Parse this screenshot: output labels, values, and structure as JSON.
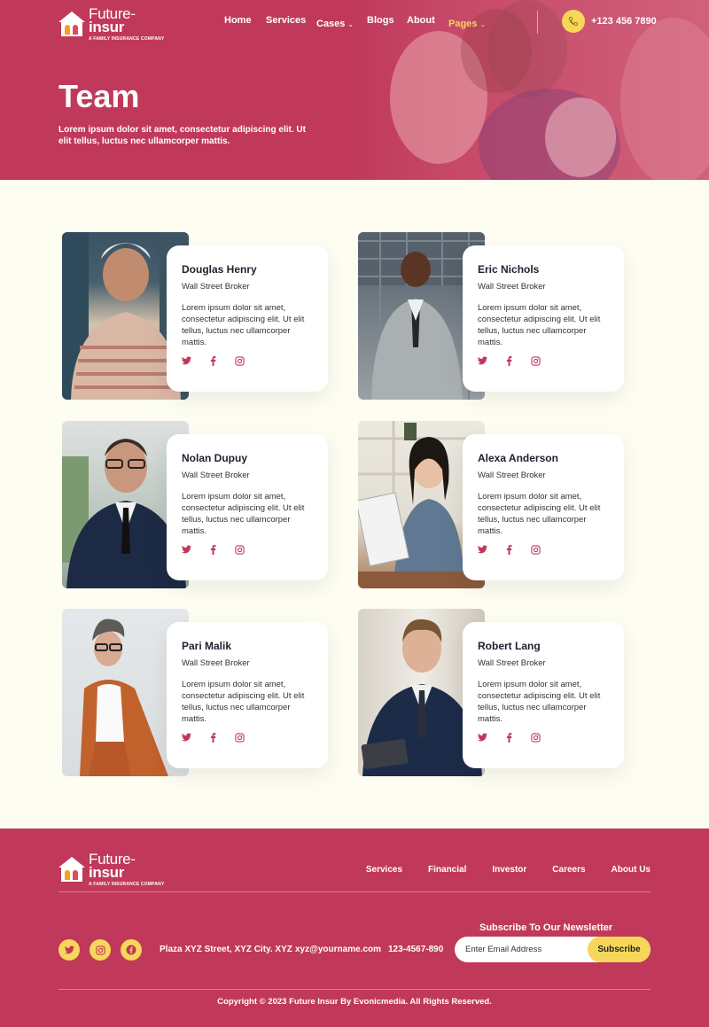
{
  "brand": {
    "name_line1": "Future-",
    "name_line2": "insur",
    "tagline": "A FAMILY INSURANCE COMPANY"
  },
  "nav": {
    "items": [
      {
        "label": "Home"
      },
      {
        "label": "Services"
      },
      {
        "label": "Cases"
      },
      {
        "label": "Blogs"
      },
      {
        "label": "About"
      },
      {
        "label": "Pages"
      }
    ],
    "phone": "+123 456 7890",
    "active_item": "Pages"
  },
  "hero": {
    "title": "Team",
    "description": "Lorem ipsum dolor sit amet, consectetur adipiscing elit. Ut elit tellus, luctus nec ullamcorper mattis."
  },
  "team": {
    "members": [
      {
        "name": "Douglas Henry",
        "role": "Wall Street Broker",
        "bio": "Lorem ipsum dolor sit amet, consectetur adipiscing elit. Ut elit tellus, luctus nec ullamcorper mattis."
      },
      {
        "name": "Eric Nichols",
        "role": "Wall Street Broker",
        "bio": "Lorem ipsum dolor sit amet, consectetur adipiscing elit. Ut elit tellus, luctus nec ullamcorper mattis."
      },
      {
        "name": "Nolan Dupuy",
        "role": "Wall Street Broker",
        "bio": "Lorem ipsum dolor sit amet, consectetur adipiscing elit. Ut elit tellus, luctus nec ullamcorper mattis."
      },
      {
        "name": "Alexa Anderson",
        "role": "Wall Street Broker",
        "bio": "Lorem ipsum dolor sit amet, consectetur adipiscing elit. Ut elit tellus, luctus nec ullamcorper mattis."
      },
      {
        "name": "Pari Malik",
        "role": "Wall Street Broker",
        "bio": "Lorem ipsum dolor sit amet, consectetur adipiscing elit. Ut elit tellus, luctus nec ullamcorper mattis."
      },
      {
        "name": "Robert Lang",
        "role": "Wall Street Broker",
        "bio": "Lorem ipsum dolor sit amet, consectetur adipiscing elit. Ut elit tellus, luctus nec ullamcorper mattis."
      }
    ],
    "social_icons": [
      "twitter-icon",
      "facebook-icon",
      "instagram-icon"
    ]
  },
  "footer": {
    "nav": [
      {
        "label": "Services"
      },
      {
        "label": "Financial"
      },
      {
        "label": "Investor"
      },
      {
        "label": "Careers"
      },
      {
        "label": "About Us"
      }
    ],
    "social_icons": [
      "twitter-icon",
      "instagram-icon",
      "facebook-icon"
    ],
    "address": "Plaza XYZ Street, XYZ City. XYZ",
    "email": "xyz@yourname.com",
    "phone": "123-4567-890",
    "newsletter_title": "Subscribe To Our Newsletter",
    "newsletter_placeholder": "Enter Email Address",
    "subscribe_label": "Subscribe",
    "copyright": "Copyright © 2023 Future Insur By Evonicmedia. All Rights Reserved."
  },
  "colors": {
    "primary": "#c0395a",
    "accent": "#f6d75a",
    "background": "#fdfdf2"
  }
}
